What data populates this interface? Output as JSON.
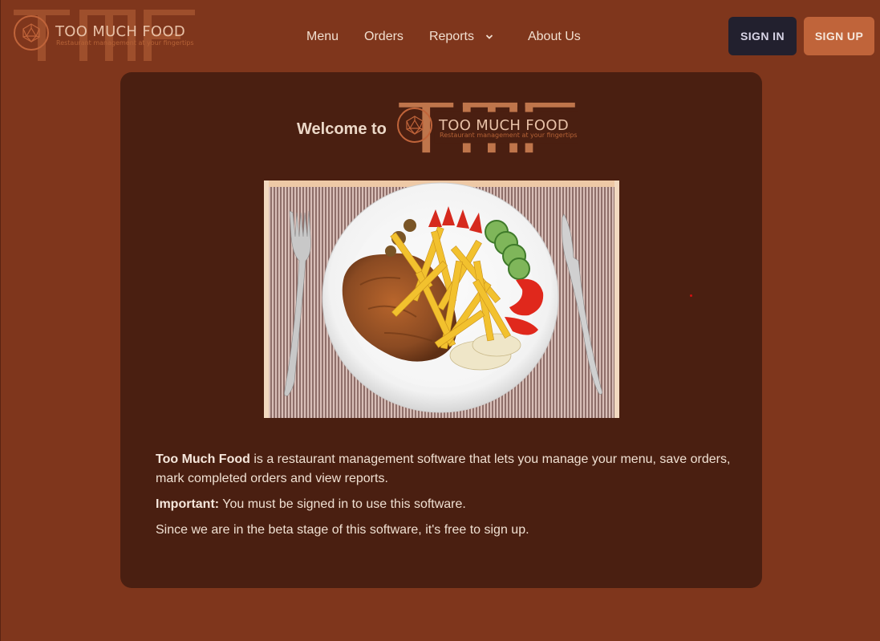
{
  "header": {
    "logo": {
      "name": "TOO MUCH FOOD",
      "tagline": "Restaurant management at your fingertips",
      "background_letters": "TMF"
    },
    "nav": {
      "menu_label": "Menu",
      "orders_label": "Orders",
      "reports_label": "Reports",
      "about_label": "About Us"
    },
    "signin_label": "SIGN IN",
    "signup_label": "SIGN UP"
  },
  "main": {
    "welcome_text": "Welcome to",
    "hero_image_icon": "plate-of-schnitzel-and-fries-image",
    "description": {
      "p1_strong": "Too Much Food",
      "p1_rest": " is a restaurant management software that lets you manage your menu, save orders, mark completed orders and view reports.",
      "p2_strong": "Important:",
      "p2_rest": " You must be signed in to use this software.",
      "p3": "Since we are in the beta stage of this software, it's free to sign up."
    }
  },
  "colors": {
    "page_background": "#7f361c",
    "card_background": "#4a1f11",
    "accent": "#c0643a",
    "signin_background": "#22202e",
    "text": "#f0e0d2"
  }
}
